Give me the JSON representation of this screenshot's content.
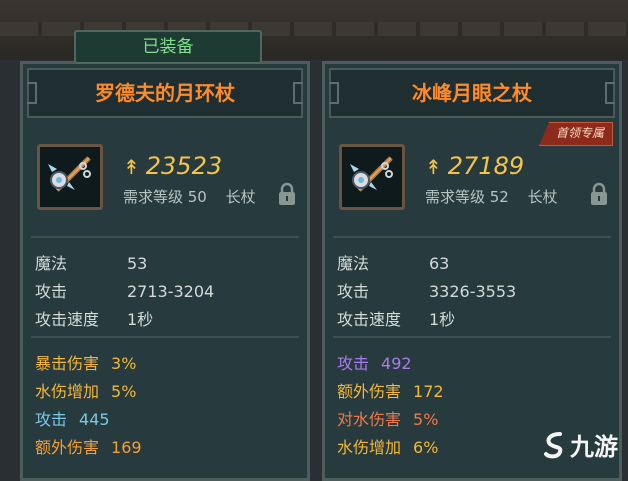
{
  "equipped_label": "已装备",
  "left": {
    "name": "罗德夫的月环杖",
    "power": "23523",
    "req": "需求等级 50",
    "type": "长杖",
    "stats": [
      {
        "label": "魔法",
        "value": "53"
      },
      {
        "label": "攻击",
        "value": "2713-3204"
      },
      {
        "label": "攻击速度",
        "value": "1秒"
      }
    ],
    "affixes": [
      {
        "label": "暴击伤害",
        "value": "3%"
      },
      {
        "label": "水伤增加",
        "value": "5%"
      },
      {
        "label": "攻击",
        "value": "445"
      },
      {
        "label": "额外伤害",
        "value": "169"
      }
    ]
  },
  "right": {
    "name": "冰峰月眼之杖",
    "tag": "首领专属",
    "power": "27189",
    "req": "需求等级 52",
    "type": "长杖",
    "stats": [
      {
        "label": "魔法",
        "value": "63"
      },
      {
        "label": "攻击",
        "value": "3326-3553"
      },
      {
        "label": "攻击速度",
        "value": "1秒"
      }
    ],
    "affixes": [
      {
        "label": "攻击",
        "value": "492"
      },
      {
        "label": "额外伤害",
        "value": "172"
      },
      {
        "label": "对水伤害",
        "value": "5%"
      },
      {
        "label": "水伤增加",
        "value": "6%"
      }
    ]
  },
  "watermark": "九游",
  "icons": [
    "staff-icon",
    "power-icon",
    "lock-icon",
    "jiuyou-logo-icon"
  ],
  "colors": {
    "title": "#ff8a2a",
    "power": "#f4c34a",
    "equipped": "#7fe08a"
  }
}
